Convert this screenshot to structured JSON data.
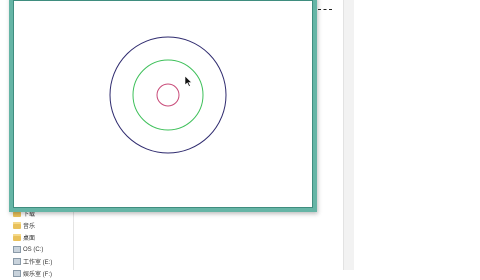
{
  "explorer": {
    "nav_items": [
      {
        "label": "下载",
        "icon": "folder-icon"
      },
      {
        "label": "音乐",
        "icon": "folder-icon"
      },
      {
        "label": "桌面",
        "icon": "folder-icon"
      },
      {
        "label": "OS (C:)",
        "icon": "drive-icon"
      },
      {
        "label": "工作室 (E:)",
        "icon": "drive-icon"
      },
      {
        "label": "娱乐室 (F:)",
        "icon": "drive-icon"
      }
    ]
  },
  "drawing": {
    "circles": [
      {
        "name": "outer-circle",
        "color": "#2e2a6e"
      },
      {
        "name": "middle-circle",
        "color": "#3ec05a"
      },
      {
        "name": "inner-circle",
        "color": "#c84a78"
      }
    ],
    "window_border_color": "#66b5a6"
  }
}
